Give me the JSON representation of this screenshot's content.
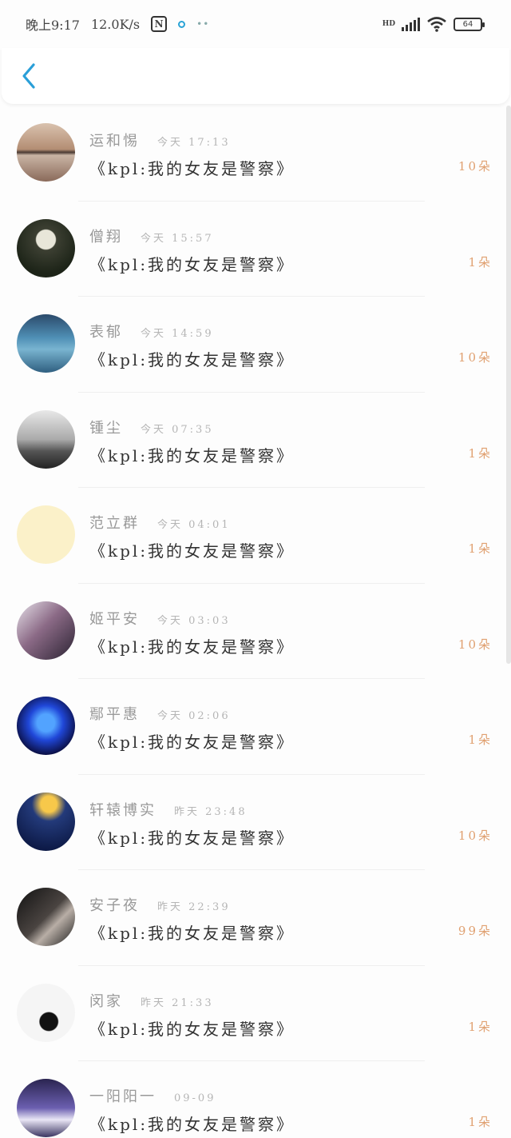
{
  "status_bar": {
    "time": "晚上9:17",
    "speed": "12.0K/s",
    "nfc": "N",
    "dots": "••",
    "network": "HD",
    "battery": "64"
  },
  "header": {
    "back_icon": "chevron-left-icon"
  },
  "items": [
    {
      "name": "运和惕",
      "time": "今天 17:13",
      "title": "《kpl:我的女友是警察》",
      "count": "10朵"
    },
    {
      "name": "僧翔",
      "time": "今天 15:57",
      "title": "《kpl:我的女友是警察》",
      "count": "1朵"
    },
    {
      "name": "表郁",
      "time": "今天 14:59",
      "title": "《kpl:我的女友是警察》",
      "count": "10朵"
    },
    {
      "name": "锺尘",
      "time": "今天 07:35",
      "title": "《kpl:我的女友是警察》",
      "count": "1朵"
    },
    {
      "name": "范立群",
      "time": "今天 04:01",
      "title": "《kpl:我的女友是警察》",
      "count": "1朵"
    },
    {
      "name": "姬平安",
      "time": "今天 03:03",
      "title": "《kpl:我的女友是警察》",
      "count": "10朵"
    },
    {
      "name": "鄢平惠",
      "time": "今天 02:06",
      "title": "《kpl:我的女友是警察》",
      "count": "1朵"
    },
    {
      "name": "轩辕博实",
      "time": "昨天 23:48",
      "title": "《kpl:我的女友是警察》",
      "count": "10朵"
    },
    {
      "name": "安子夜",
      "time": "昨天 22:39",
      "title": "《kpl:我的女友是警察》",
      "count": "99朵"
    },
    {
      "name": "闵家",
      "time": "昨天 21:33",
      "title": "《kpl:我的女友是警察》",
      "count": "1朵"
    },
    {
      "name": "一阳阳一",
      "time": "09-09",
      "title": "《kpl:我的女友是警察》",
      "count": "1朵"
    }
  ],
  "colors": {
    "accent": "#2a9fd8",
    "count": "#e0a070"
  }
}
